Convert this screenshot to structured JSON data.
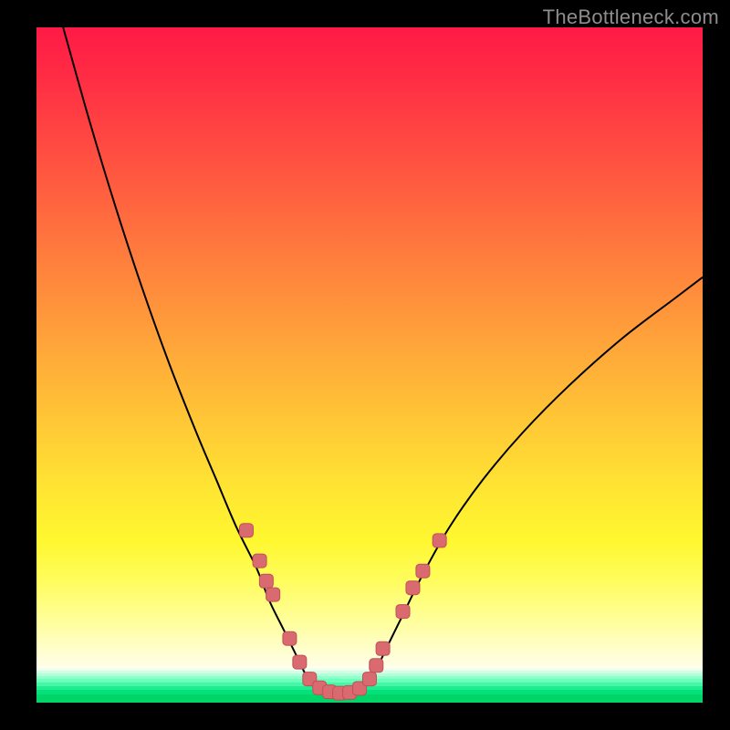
{
  "watermark": "TheBottleneck.com",
  "colors": {
    "frame": "#000000",
    "gradient_top": "#ff1a46",
    "gradient_mid": "#ffe333",
    "gradient_low": "#fffeea",
    "green_dark": "#00d667",
    "green_light": "#d8ffe9",
    "curve": "#000000",
    "marker_fill": "#d96a6f",
    "marker_stroke": "#c24f57"
  },
  "chart_data": {
    "type": "line",
    "title": "",
    "xlabel": "",
    "ylabel": "",
    "xlim": [
      0,
      100
    ],
    "ylim": [
      0,
      100
    ],
    "series": [
      {
        "name": "left-curve",
        "x": [
          4,
          8,
          12,
          16,
          20,
          24,
          27,
          30,
          33,
          35,
          37,
          39,
          40.5,
          42
        ],
        "y": [
          100,
          86,
          73,
          61,
          50,
          40,
          33,
          26,
          20,
          15,
          11,
          7,
          4,
          2
        ]
      },
      {
        "name": "right-curve",
        "x": [
          49,
          51,
          53,
          55,
          58,
          62,
          67,
          73,
          80,
          88,
          96,
          100
        ],
        "y": [
          2,
          5,
          9,
          13,
          19,
          26,
          33,
          40,
          47,
          54,
          60,
          63
        ]
      },
      {
        "name": "valley-floor",
        "x": [
          40.5,
          43,
          46,
          49
        ],
        "y": [
          2,
          1.3,
          1.3,
          2
        ]
      }
    ],
    "markers": [
      {
        "x": 31.5,
        "y": 25.5
      },
      {
        "x": 33.5,
        "y": 21
      },
      {
        "x": 34.5,
        "y": 18
      },
      {
        "x": 35.5,
        "y": 16
      },
      {
        "x": 38,
        "y": 9.5
      },
      {
        "x": 39.5,
        "y": 6
      },
      {
        "x": 41,
        "y": 3.5
      },
      {
        "x": 42.5,
        "y": 2.2
      },
      {
        "x": 44,
        "y": 1.6
      },
      {
        "x": 45.5,
        "y": 1.4
      },
      {
        "x": 47,
        "y": 1.5
      },
      {
        "x": 48.5,
        "y": 2.1
      },
      {
        "x": 50,
        "y": 3.5
      },
      {
        "x": 51,
        "y": 5.5
      },
      {
        "x": 52,
        "y": 8
      },
      {
        "x": 55,
        "y": 13.5
      },
      {
        "x": 56.5,
        "y": 17
      },
      {
        "x": 58,
        "y": 19.5
      },
      {
        "x": 60.5,
        "y": 24
      }
    ],
    "green_bands_pct_height": [
      0.3,
      0.35,
      0.4,
      0.45,
      0.5,
      0.55,
      0.6,
      0.7,
      1.2
    ]
  }
}
